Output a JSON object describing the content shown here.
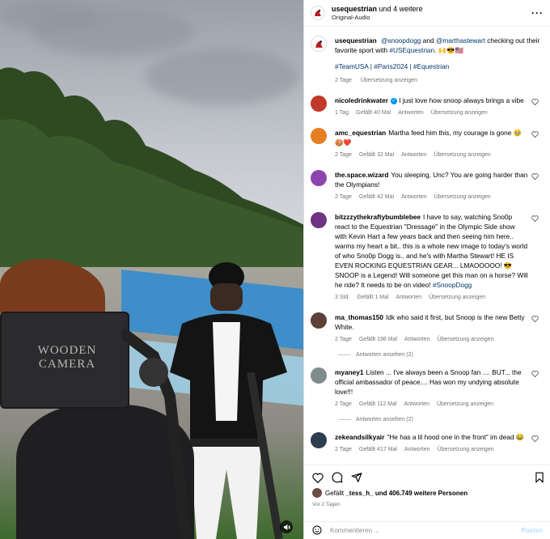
{
  "media": {
    "camera_label_line1": "WOODEN",
    "camera_label_line2": "CAMERA",
    "audio_icon": "speaker-icon"
  },
  "header": {
    "username": "usequestrian",
    "coauthors": "und 4 weitere",
    "subtitle": "Original-Audio",
    "more_icon": "more-horizontal-icon"
  },
  "caption": {
    "username": "usequestrian",
    "mention1": "@snoopdogg",
    "and": "and",
    "mention2": "@marthastewart",
    "text": "checking out their favorite sport with",
    "tag_inline": "#USEquestrian.",
    "emoji": "🙌😎🇺🇸",
    "hashtags": "#TeamUSA | #Paris2024 | #Equestrian",
    "time": "2 Tage",
    "translate": "Übersetzung anzeigen"
  },
  "comments": [
    {
      "username": "nicoledrinkwater",
      "verified": true,
      "text": "I just love how snoop always brings a vibe",
      "time": "1 Tag",
      "likes": "Gefällt 40 Mal",
      "reply": "Antworten",
      "translate": "Übersetzung anzeigen",
      "avatar_color": "#c0392b"
    },
    {
      "username": "amc_equestrian",
      "text": "Martha feed him this, my courage is gone 🥹🍪❤️",
      "time": "2 Tage",
      "likes": "Gefällt 32 Mal",
      "reply": "Antworten",
      "translate": "Übersetzung anzeigen",
      "avatar_color": "#e67e22"
    },
    {
      "username": "the.space.wizard",
      "text": "You sleeping, Unc? You are going harder than the Olympians!",
      "time": "2 Tage",
      "likes": "Gefällt 42 Mal",
      "reply": "Antworten",
      "translate": "Übersetzung anzeigen",
      "avatar_color": "#8e44ad"
    },
    {
      "username": "bitzzzythekraftybumblebee",
      "text": "I have to say, watching Sno0p react to the Equestrian \"Dressage\" in the Olympic Side show with Kevin Hart a few years back and then seeing him here.. warms my heart a bit.. this is a whole new image to today's world of who Sno0p Dogg is.. and he's with Martha Stewart! HE IS EVEN ROCKING EQUESTRIAN GEAR... LMAOOOOO! 😎 SNOOP is a Legend! Will someone get this man on a horse? Will he ride? It needs to be on video!",
      "hashtag": "#SnoopDogg",
      "time": "3 Std.",
      "likes": "Gefällt 1 Mal",
      "reply": "Antworten",
      "translate": "Übersetzung anzeigen",
      "avatar_color": "#6c3483"
    },
    {
      "username": "ma_thomas150",
      "text": "Idk who said it first, but Snoop is the new Betty White.",
      "time": "2 Tage",
      "likes": "Gefällt 198 Mal",
      "reply": "Antworten",
      "translate": "Übersetzung anzeigen",
      "view_replies": "Antworten ansehen (2)",
      "avatar_color": "#5d4037"
    },
    {
      "username": "myaney1",
      "text": "Listen ... I've always been a Snoop fan .... BUT... the official ambassador of peace.... Has won my undying absolute love!!!",
      "time": "2 Tage",
      "likes": "Gefällt 112 Mal",
      "reply": "Antworten",
      "translate": "Übersetzung anzeigen",
      "view_replies": "Antworten ansehen (2)",
      "avatar_color": "#7f8c8d"
    },
    {
      "username": "zekeandsilkyair",
      "text": "\"He has a lil hood one in the front\" im dead 😂",
      "time": "2 Tage",
      "likes": "Gefällt 417 Mal",
      "reply": "Antworten",
      "translate": "Übersetzung anzeigen",
      "avatar_color": "#2c3e50"
    }
  ],
  "actions": {
    "like_icon": "heart-icon",
    "comment_icon": "comment-icon",
    "share_icon": "send-icon",
    "save_icon": "bookmark-icon",
    "liked_by_prefix": "Gefällt",
    "liked_by_user": "_tess_h_",
    "liked_by_suffix": "und 406.749 weitere Personen",
    "date": "Vor 2 Tagen",
    "comment_placeholder": "Kommentieren ...",
    "post_label": "Posten",
    "emoji_icon": "emoji-icon"
  }
}
